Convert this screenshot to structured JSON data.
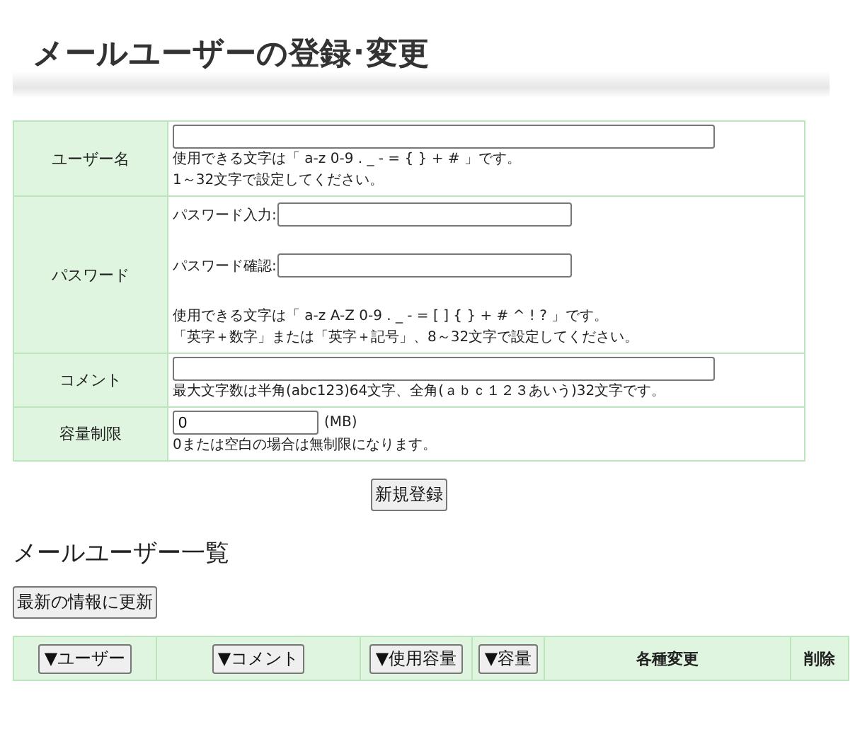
{
  "title": "メールユーザーの登録･変更",
  "form": {
    "rows": [
      {
        "kind": "user",
        "label": "ユーザー名",
        "notes": [
          "使用できる文字は「 a-z 0-9 . _ - = { } + #  」です。",
          "1～32文字で設定してください。"
        ]
      },
      {
        "kind": "password",
        "label": "パスワード",
        "fields": [
          {
            "label": "パスワード入力:"
          },
          {
            "label": "パスワード確認:"
          }
        ],
        "notes": [
          "使用できる文字は「 a-z A-Z 0-9 . _ - = [ ] { } + # ^ ! ? 」です。",
          "「英字＋数字」または「英字＋記号」、8～32文字で設定してください。"
        ]
      },
      {
        "kind": "comment",
        "label": "コメント",
        "notes": [
          "最大文字数は半角(abc123)64文字、全角(ａｂｃ１２３あいう)32文字です。"
        ]
      },
      {
        "kind": "quota",
        "label": "容量制限",
        "value": "0",
        "unit": "(MB)",
        "notes": [
          "0または空白の場合は無制限になります。"
        ]
      }
    ]
  },
  "register_button": "新規登録",
  "list_title": "メールユーザー一覧",
  "refresh_button": "最新の情報に更新",
  "columns": [
    {
      "kind": "sort",
      "label": "▼ユーザー"
    },
    {
      "kind": "sort",
      "label": "▼コメント"
    },
    {
      "kind": "sort",
      "label": "▼使用容量"
    },
    {
      "kind": "sort",
      "label": "▼容量"
    },
    {
      "kind": "text",
      "label": "各種変更"
    },
    {
      "kind": "text",
      "label": "削除"
    }
  ]
}
